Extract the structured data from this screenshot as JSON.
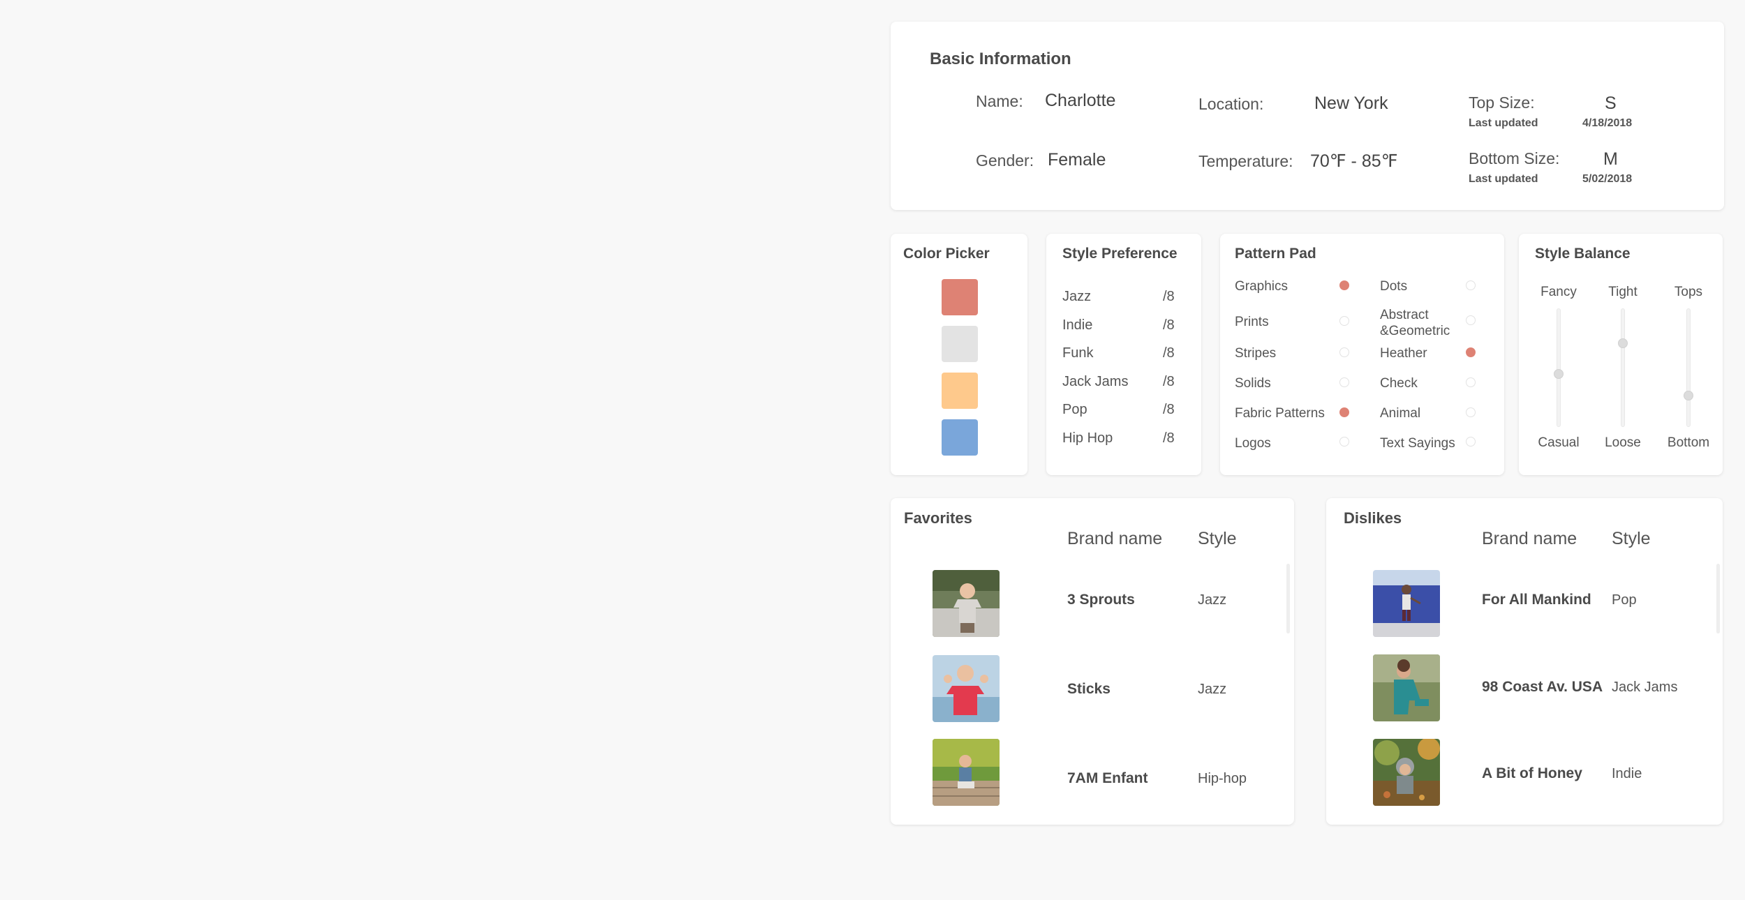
{
  "basic_info": {
    "title": "Basic Information",
    "name_label": "Name:",
    "name_value": "Charlotte",
    "gender_label": "Gender:",
    "gender_value": "Female",
    "location_label": "Location:",
    "location_value": "New York",
    "temperature_label": "Temperature:",
    "temperature_value": "70℉ - 85℉",
    "top_size_label": "Top Size:",
    "top_size_value": "S",
    "top_last_updated_label": "Last updated",
    "top_last_updated_value": "4/18/2018",
    "bottom_size_label": "Bottom Size:",
    "bottom_size_value": "M",
    "bottom_last_updated_label": "Last updated",
    "bottom_last_updated_value": "5/02/2018"
  },
  "color_picker": {
    "title": "Color Picker",
    "swatches": [
      "#de8274",
      "#e3e3e3",
      "#fec98c",
      "#7aa6da"
    ]
  },
  "style_preference": {
    "title": "Style Preference",
    "items": [
      {
        "label": "Jazz",
        "value": "/8"
      },
      {
        "label": "Indie",
        "value": "/8"
      },
      {
        "label": "Funk",
        "value": "/8"
      },
      {
        "label": "Jack Jams",
        "value": "/8"
      },
      {
        "label": "Pop",
        "value": "/8"
      },
      {
        "label": "Hip Hop",
        "value": "/8"
      }
    ]
  },
  "pattern_pad": {
    "title": "Pattern Pad",
    "accent": "#de8274",
    "left_column": [
      {
        "label": "Graphics",
        "selected": true
      },
      {
        "label": "Prints",
        "selected": false
      },
      {
        "label": "Stripes",
        "selected": false
      },
      {
        "label": "Solids",
        "selected": false
      },
      {
        "label": "Fabric Patterns",
        "selected": true
      },
      {
        "label": "Logos",
        "selected": false
      }
    ],
    "right_column": [
      {
        "label": "Dots",
        "selected": false
      },
      {
        "label": "Abstract &Geometric",
        "selected": false
      },
      {
        "label": "Heather",
        "selected": true
      },
      {
        "label": "Check",
        "selected": false
      },
      {
        "label": "Animal",
        "selected": false
      },
      {
        "label": "Text Sayings",
        "selected": false
      }
    ]
  },
  "style_balance": {
    "title": "Style Balance",
    "sliders": [
      {
        "top": "Fancy",
        "bottom": "Casual",
        "level": 0.45
      },
      {
        "top": "Tight",
        "bottom": "Loose",
        "level": 0.73
      },
      {
        "top": "Tops",
        "bottom": "Bottom",
        "level": 0.25
      }
    ]
  },
  "favorites": {
    "title": "Favorites",
    "col_brand": "Brand name",
    "col_style": "Style",
    "rows": [
      {
        "brand": "3 Sprouts",
        "style": "Jazz",
        "image": "boy-in-grey-tshirt-photo"
      },
      {
        "brand": "Sticks",
        "style": "Jazz",
        "image": "boy-in-red-tshirt-photo"
      },
      {
        "brand": "7AM Enfant",
        "style": "Hip-hop",
        "image": "boy-squatting-on-deck-photo"
      }
    ]
  },
  "dislikes": {
    "title": "Dislikes",
    "col_brand": "Brand name",
    "col_style": "Style",
    "rows": [
      {
        "brand": "For All Mankind",
        "style": "Pop",
        "image": "girl-at-blue-wall-photo"
      },
      {
        "brand": "98 Coast Av. USA",
        "style": "Jack Jams",
        "image": "girl-in-teal-outfit-photo"
      },
      {
        "brand": "A Bit of Honey",
        "style": "Indie",
        "image": "child-in-autumn-leaves-photo"
      }
    ]
  }
}
